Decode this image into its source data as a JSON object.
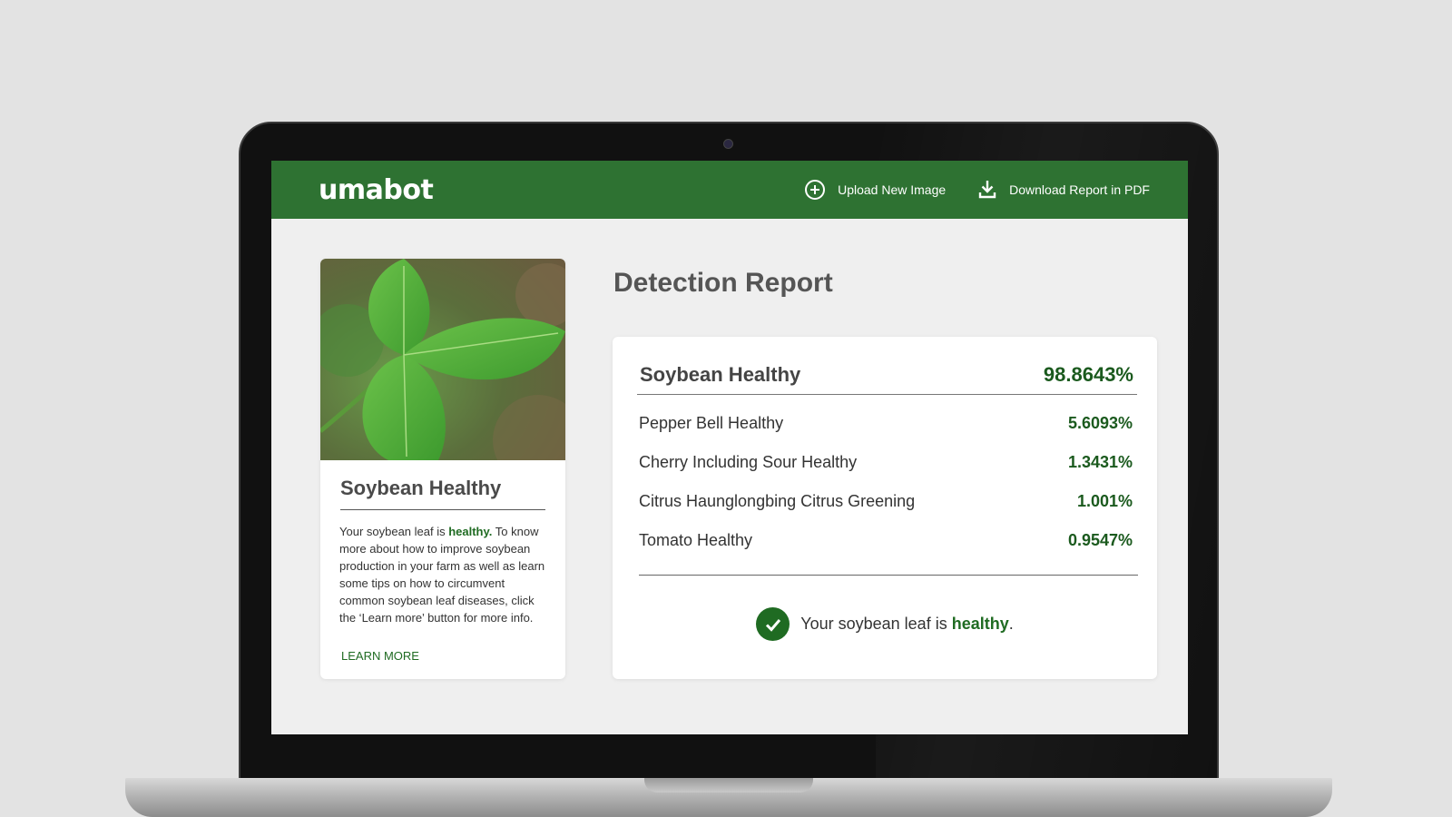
{
  "header": {
    "logo": "umabot",
    "upload_label": "Upload New Image",
    "download_label": "Download Report in PDF"
  },
  "sample": {
    "title": "Soybean Healthy",
    "description_pre": "Your soybean leaf is ",
    "description_status": "healthy.",
    "description_post": " To know more about how to improve soybean production in your farm as well as learn some tips on how to circumvent common soybean leaf diseases, click the ‘Learn more’ button for more info.",
    "learn_more": "LEARN MORE"
  },
  "report": {
    "title": "Detection Report",
    "top": {
      "label": "Soybean Healthy",
      "value": "98.8643%"
    },
    "results": [
      {
        "label": "Pepper Bell Healthy",
        "value": "5.6093%"
      },
      {
        "label": "Cherry Including Sour Healthy",
        "value": "1.3431%"
      },
      {
        "label": "Citrus Haunglongbing Citrus Greening",
        "value": "1.001%"
      },
      {
        "label": "Tomato Healthy",
        "value": "0.9547%"
      }
    ],
    "verdict_pre": "Your soybean leaf is ",
    "verdict_status": "healthy",
    "verdict_post": "."
  },
  "colors": {
    "brand_green": "#2e7232",
    "value_green": "#1b5a1e"
  },
  "icons": [
    "plus-circle-icon",
    "download-icon",
    "check-icon",
    "leaf-photo"
  ]
}
